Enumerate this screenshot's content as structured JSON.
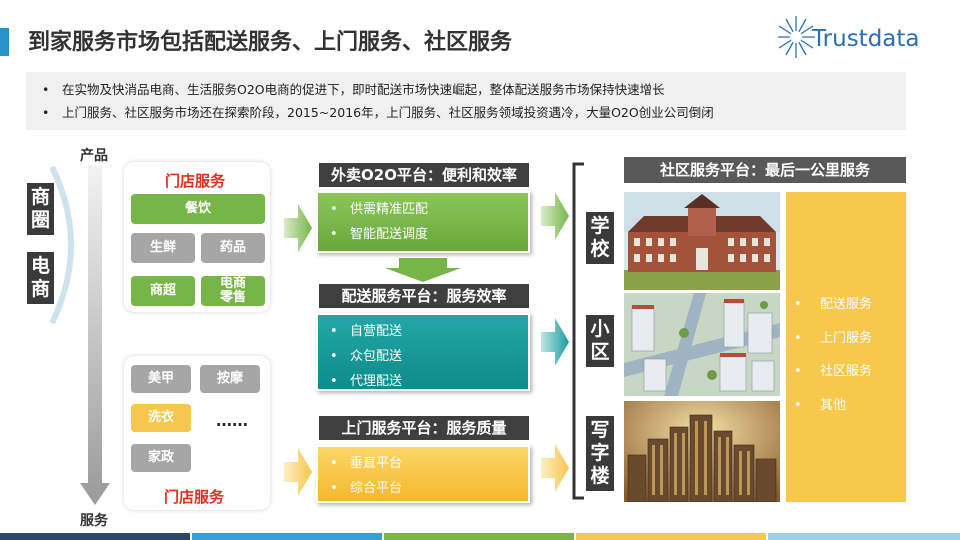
{
  "header": {
    "title": "到家服务市场包括配送服务、上门服务、社区服务",
    "logo_text": "Trustdata"
  },
  "bullets": [
    "在实物及快消品电商、生活服务O2O电商的促进下，即时配送市场快速崛起，整体配送服务市场保持快速增长",
    "上门服务、社区服务市场还在探索阶段，2015~2016年，上门服务、社区服务领域投资遇冷，大量O2O创业公司倒闭"
  ],
  "axis": {
    "top_label": "产品",
    "bottom_label": "服务"
  },
  "side_tags": [
    "商圈",
    "电商"
  ],
  "store_card_top": {
    "title": "门店服务",
    "tiles": [
      {
        "label": "餐饮",
        "color": "green"
      },
      {
        "label": "生鲜",
        "color": "gray"
      },
      {
        "label": "药品",
        "color": "gray"
      },
      {
        "label": "商超",
        "color": "green"
      },
      {
        "label": "电商零售",
        "color": "green"
      }
    ]
  },
  "store_card_bottom": {
    "title": "门店服务",
    "tiles": [
      {
        "label": "美甲",
        "color": "gray"
      },
      {
        "label": "按摩",
        "color": "gray"
      },
      {
        "label": "洗衣",
        "color": "yellow"
      },
      {
        "label": "家政",
        "color": "gray"
      }
    ],
    "ellipsis": "……"
  },
  "platforms": [
    {
      "title": "外卖O2O平台：便利和效率",
      "items": [
        "供需精准匹配",
        "智能配送调度"
      ]
    },
    {
      "title": "配送服务平台：服务效率",
      "items": [
        "自营配送",
        "众包配送",
        "代理配送"
      ]
    },
    {
      "title": "上门服务平台：服务质量",
      "items": [
        "垂直平台",
        "综合平台"
      ]
    }
  ],
  "places": [
    "学校",
    "小区",
    "写字楼"
  ],
  "community": {
    "title": "社区服务平台：最后一公里服务",
    "services": [
      "配送服务",
      "上门服务",
      "社区服务",
      "其他"
    ]
  },
  "colors": {
    "accent_blue": "#2b8fc9",
    "green": "#78b548",
    "teal": "#1a9c9c",
    "yellow": "#f8c84d",
    "dark": "#3f3f3f"
  }
}
